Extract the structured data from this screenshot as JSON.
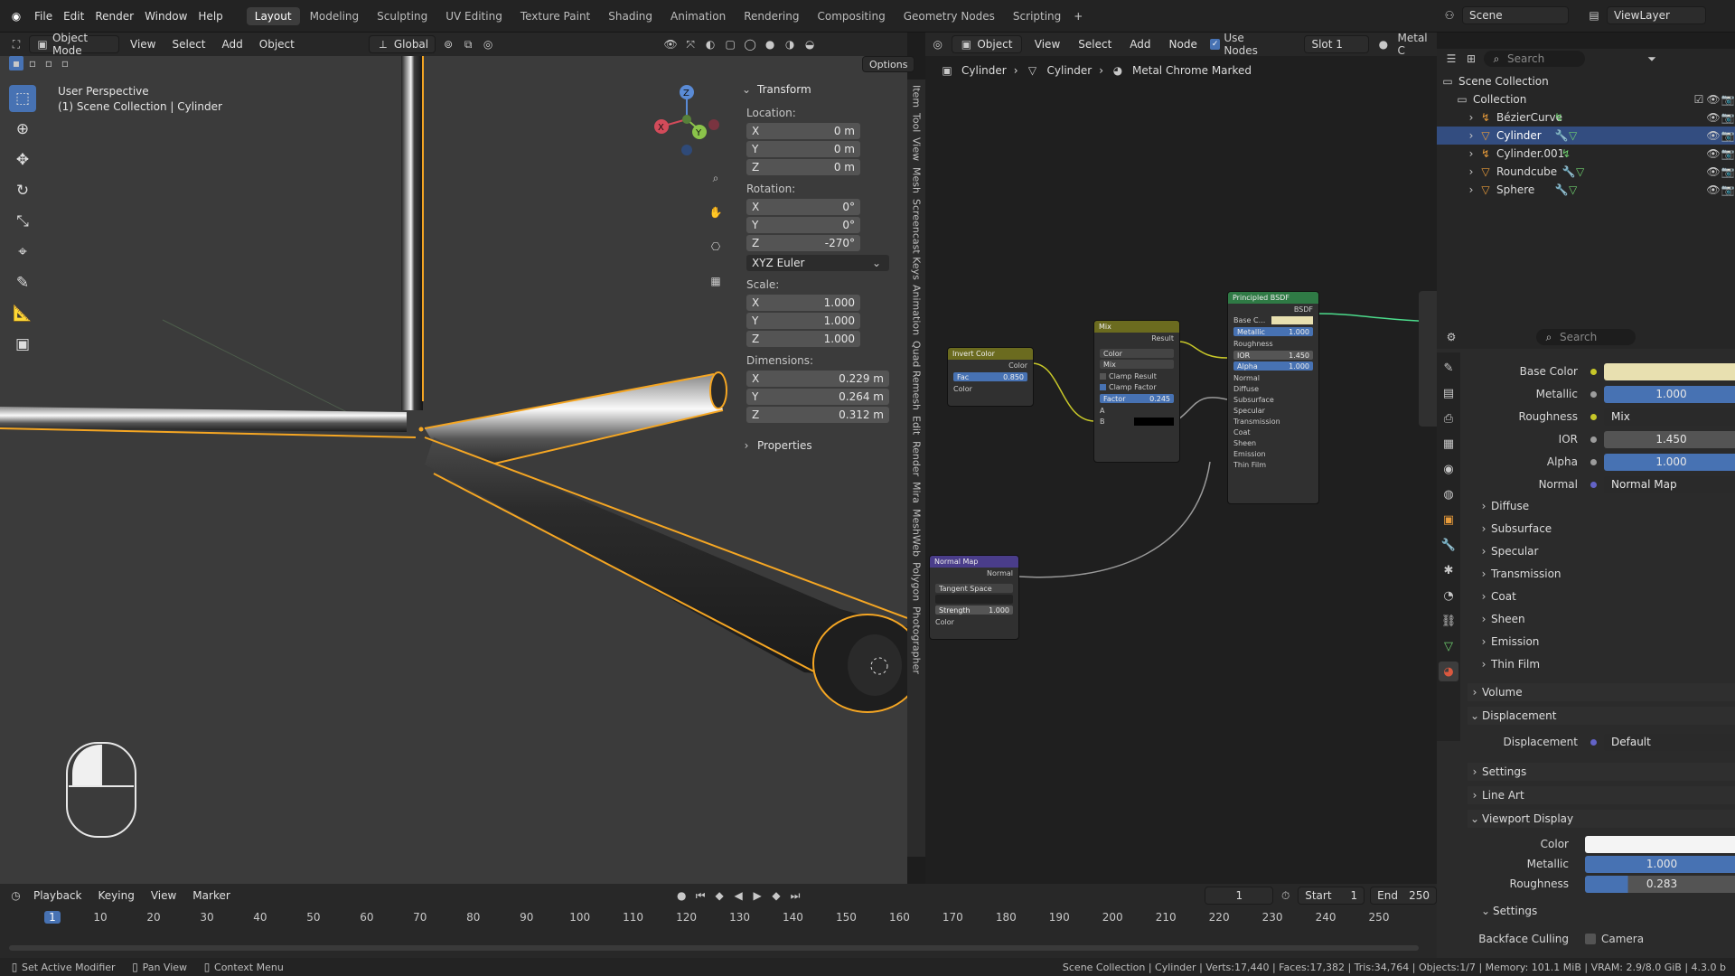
{
  "topbar": {
    "menus": [
      "File",
      "Edit",
      "Render",
      "Window",
      "Help"
    ],
    "workspaces": [
      "Layout",
      "Modeling",
      "Sculpting",
      "UV Editing",
      "Texture Paint",
      "Shading",
      "Animation",
      "Rendering",
      "Compositing",
      "Geometry Nodes",
      "Scripting"
    ],
    "active_workspace": "Layout",
    "scene": "Scene",
    "view_layer": "ViewLayer"
  },
  "viewport": {
    "mode": "Object Mode",
    "menus": [
      "View",
      "Select",
      "Add",
      "Object"
    ],
    "orientation": "Global",
    "options": "Options",
    "overlay_title": "User Perspective",
    "overlay_sub": "(1) Scene Collection | Cylinder",
    "gizmo_labels": [
      "Z",
      "Y",
      "X"
    ]
  },
  "npanel": {
    "transform": "Transform",
    "location_label": "Location:",
    "location": {
      "x": "0 m",
      "y": "0 m",
      "z": "0 m"
    },
    "rotation_label": "Rotation:",
    "rotation": {
      "x": "0°",
      "y": "0°",
      "z": "-270°"
    },
    "rotation_mode": "XYZ Euler",
    "scale_label": "Scale:",
    "scale": {
      "x": "1.000",
      "y": "1.000",
      "z": "1.000"
    },
    "dimensions_label": "Dimensions:",
    "dimensions": {
      "x": "0.229 m",
      "y": "0.264 m",
      "z": "0.312 m"
    },
    "properties": "Properties",
    "axis": {
      "x": "X",
      "y": "Y",
      "z": "Z"
    }
  },
  "sidetabs": [
    "Item",
    "Tool",
    "View",
    "Mesh",
    "Screencast Keys",
    "Animation",
    "Quad Remesh",
    "Edit",
    "Render",
    "Mira",
    "MeshWeb",
    "Polygon",
    "Photographer"
  ],
  "node_editor": {
    "menus": [
      "View",
      "Select",
      "Add",
      "Node"
    ],
    "object_label": "Object",
    "use_nodes": "Use Nodes",
    "slot": "Slot 1",
    "material_short": "Metal C",
    "breadcrumb": [
      "Cylinder",
      "Cylinder",
      "Metal Chrome Marked"
    ],
    "invert": {
      "title": "Invert Color",
      "out": "Color",
      "fac_label": "Fac",
      "fac": "0.850",
      "in": "Color"
    },
    "mix": {
      "title": "Mix",
      "out": "Result",
      "type": "Color",
      "blend": "Mix",
      "clamp_result": "Clamp Result",
      "clamp_factor": "Clamp Factor",
      "factor_label": "Factor",
      "factor": "0.245",
      "a": "A",
      "b": "B"
    },
    "bsdf": {
      "title": "Principled BSDF",
      "out": "BSDF",
      "base": "Base C...",
      "metallic_label": "Metallic",
      "metallic": "1.000",
      "roughness": "Roughness",
      "ior_label": "IOR",
      "ior": "1.450",
      "alpha_label": "Alpha",
      "alpha": "1.000",
      "normal": "Normal",
      "panels": [
        "Diffuse",
        "Subsurface",
        "Specular",
        "Transmission",
        "Coat",
        "Sheen",
        "Emission",
        "Thin Film"
      ]
    },
    "normalmap": {
      "title": "Normal Map",
      "out": "Normal",
      "space": "Tangent Space",
      "strength_label": "Strength",
      "strength": "1.000",
      "in": "Color"
    }
  },
  "outliner": {
    "search_placeholder": "Search",
    "root": "Scene Collection",
    "collection": "Collection",
    "items": [
      "BézierCurve",
      "Cylinder",
      "Cylinder.001",
      "Roundcube",
      "Sphere"
    ],
    "selected": "Cylinder"
  },
  "properties": {
    "search_placeholder": "Search",
    "base_color_label": "Base Color",
    "metallic_label": "Metallic",
    "metallic": "1.000",
    "roughness_label": "Roughness",
    "roughness": "Mix",
    "ior_label": "IOR",
    "ior": "1.450",
    "alpha_label": "Alpha",
    "alpha": "1.000",
    "normal_label": "Normal",
    "normal": "Normal Map",
    "subpanels": [
      "Diffuse",
      "Subsurface",
      "Specular",
      "Transmission",
      "Coat",
      "Sheen",
      "Emission",
      "Thin Film"
    ],
    "volume": "Volume",
    "displacement_section": "Displacement",
    "displacement_label": "Displacement",
    "displacement": "Default",
    "settings": "Settings",
    "line_art": "Line Art",
    "viewport_display": "Viewport Display",
    "vd_color_label": "Color",
    "vd_metallic_label": "Metallic",
    "vd_metallic": "1.000",
    "vd_roughness_label": "Roughness",
    "vd_roughness": "0.283",
    "vd_settings": "Settings",
    "backface_label": "Backface Culling",
    "backface_camera": "Camera"
  },
  "timeline": {
    "menus": [
      "Playback",
      "Keying",
      "View",
      "Marker"
    ],
    "current_frame": "1",
    "start_label": "Start",
    "start": "1",
    "end_label": "End",
    "end": "250",
    "ticks": [
      "1",
      "10",
      "20",
      "30",
      "40",
      "50",
      "60",
      "70",
      "80",
      "90",
      "100",
      "110",
      "120",
      "130",
      "140",
      "150",
      "160",
      "170",
      "180",
      "190",
      "200",
      "210",
      "220",
      "230",
      "240",
      "250"
    ]
  },
  "statusbar": {
    "left": [
      "Set Active Modifier",
      "Pan View",
      "Context Menu"
    ],
    "right": "Scene Collection | Cylinder | Verts:17,440 | Faces:17,382 | Tris:34,764 | Objects:1/7 | Memory: 101.1 MiB | VRAM: 2.9/8.0 GiB | 4.3.0 b"
  },
  "colors": {
    "accent": "#4772b3",
    "selection_outline": "#f5a623",
    "base_color": "#e8e0b0"
  }
}
